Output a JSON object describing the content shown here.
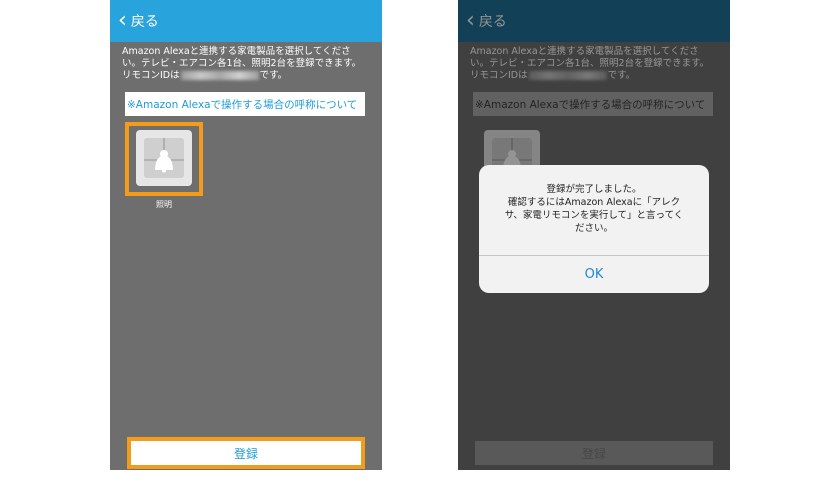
{
  "nav": {
    "back_label": "戻る"
  },
  "description": {
    "line1": "Amazon Alexaと連携する家電製品を選択してくださ",
    "line2": "い。テレビ・エアコン各1台、照明2台を登録できます。",
    "line3_prefix": "リモコンIDは",
    "line3_suffix": "です。"
  },
  "info_link": "※Amazon Alexaで操作する場合の呼称について",
  "device": {
    "label": "照明",
    "icon": "ceiling-light-icon"
  },
  "register_label": "登録",
  "dialog": {
    "line1": "登録が完了しました。",
    "line2": "確認するにはAmazon Alexaに「アレク",
    "line3": "サ、家電リモコンを実行して」と言ってく",
    "line4": "ださい。",
    "ok_label": "OK"
  },
  "colors": {
    "accent": "#29a3dc",
    "highlight": "#f39c1b",
    "background": "#6e6e6e"
  }
}
